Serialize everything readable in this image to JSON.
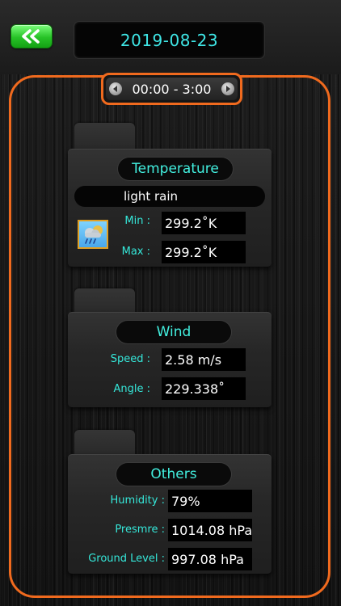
{
  "header": {
    "date": "2019-08-23",
    "back_icon": "double-chevron-left-icon",
    "back_color": "#27c227"
  },
  "time_selector": {
    "range": "00:00 - 3:00",
    "prev_icon": "triangle-left-icon",
    "next_icon": "triangle-right-icon"
  },
  "temperature": {
    "title": "Temperature",
    "description": "light rain",
    "icon": "rain-cloud-icon",
    "min_label": "Min :",
    "min_value": "299.2˚K",
    "max_label": "Max :",
    "max_value": "299.2˚K"
  },
  "wind": {
    "title": "Wind",
    "speed_label": "Speed :",
    "speed_value": "2.58 m/s",
    "angle_label": "Angle :",
    "angle_value": "229.338˚"
  },
  "others": {
    "title": "Others",
    "humidity_label": "Humidity :",
    "humidity_value": "79%",
    "pressure_label": "Presmre :",
    "pressure_value": "1014.08 hPa",
    "ground_label": "Ground Level :",
    "ground_value": "997.08 hPa"
  },
  "colors": {
    "accent_orange": "#f06a1e",
    "accent_cyan": "#35e8da"
  }
}
